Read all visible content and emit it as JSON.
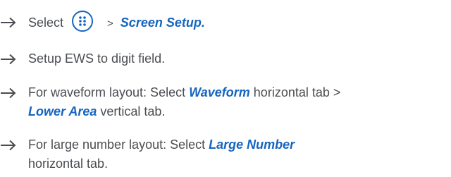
{
  "steps": [
    {
      "select_label": "Select",
      "separator": ">",
      "target_label": "Screen Setup.",
      "icon": "menu-grid-icon"
    },
    {
      "text": "Setup EWS to digit field."
    },
    {
      "prefix": "For waveform layout: Select ",
      "target1": "Waveform",
      "middle": " horizontal tab > ",
      "target2": "Lower Area",
      "suffix": " vertical tab."
    },
    {
      "prefix": "For large number layout: Select ",
      "target1": "Large Number",
      "suffix": " horizontal tab."
    }
  ],
  "colors": {
    "accent": "#1565c0",
    "text": "#4a4d51"
  }
}
